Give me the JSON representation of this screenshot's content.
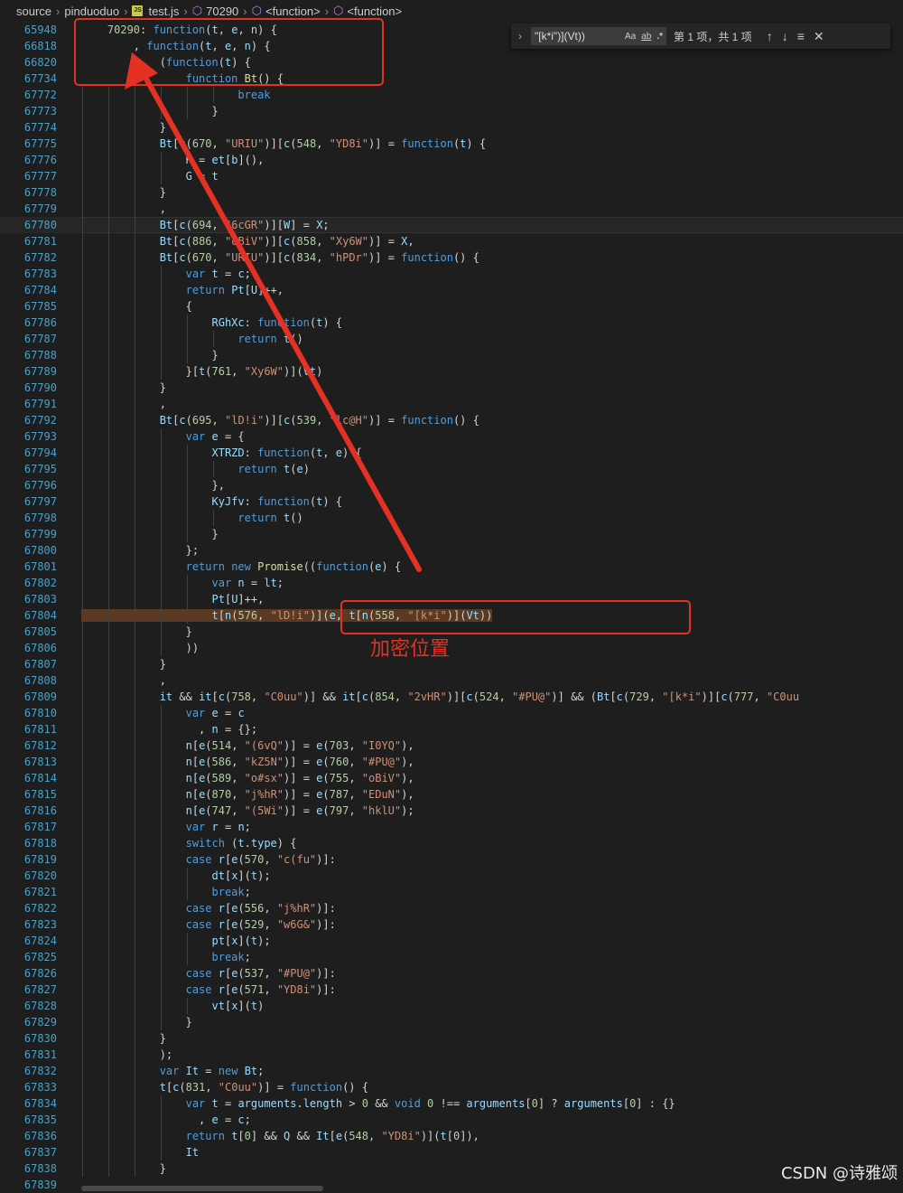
{
  "breadcrumb": [
    "source",
    "pinduoduo",
    "test.js",
    "70290",
    "<function>",
    "<function>"
  ],
  "find_widget": {
    "query": "\"[k*i\")](Vt))",
    "match_case_label": "Aa",
    "whole_word_label": "ab",
    "regex_label": ".*",
    "result": "第 1 项，共 1 项"
  },
  "sticky_lines": [
    {
      "number": "65948",
      "code": "    70290: function(t, e, n) {"
    },
    {
      "number": "66818",
      "code": "        , function(t, e, n) {"
    },
    {
      "number": "66820",
      "code": "            (function(t) {"
    },
    {
      "number": "67734",
      "code": "                function Bt() {"
    }
  ],
  "code_lines": [
    {
      "number": "67772",
      "code": "                        break"
    },
    {
      "number": "67773",
      "code": "                    }"
    },
    {
      "number": "67774",
      "code": "            }"
    },
    {
      "number": "67775",
      "code": "            Bt[c(670, \"URIU\")][c(548, \"YD8i\")] = function(t) {"
    },
    {
      "number": "67776",
      "code": "                K = et[b](),"
    },
    {
      "number": "67777",
      "code": "                G = t"
    },
    {
      "number": "67778",
      "code": "            }"
    },
    {
      "number": "67779",
      "code": "            ,"
    },
    {
      "number": "67780",
      "code": "            Bt[c(694, \"6cGR\")][W] = X;"
    },
    {
      "number": "67781",
      "code": "            Bt[c(886, \"oBiV\")][c(858, \"Xy6W\")] = X,"
    },
    {
      "number": "67782",
      "code": "            Bt[c(670, \"URIU\")][c(834, \"hPDr\")] = function() {"
    },
    {
      "number": "67783",
      "code": "                var t = c;"
    },
    {
      "number": "67784",
      "code": "                return Pt[U]++,"
    },
    {
      "number": "67785",
      "code": "                {"
    },
    {
      "number": "67786",
      "code": "                    RGhXc: function(t) {"
    },
    {
      "number": "67787",
      "code": "                        return t()"
    },
    {
      "number": "67788",
      "code": "                    }"
    },
    {
      "number": "67789",
      "code": "                }[t(761, \"Xy6W\")](Vt)"
    },
    {
      "number": "67790",
      "code": "            }"
    },
    {
      "number": "67791",
      "code": "            ,"
    },
    {
      "number": "67792",
      "code": "            Bt[c(695, \"lD!i\")][c(539, \"lc@H\")] = function() {"
    },
    {
      "number": "67793",
      "code": "                var e = {"
    },
    {
      "number": "67794",
      "code": "                    XTRZD: function(t, e) {"
    },
    {
      "number": "67795",
      "code": "                        return t(e)"
    },
    {
      "number": "67796",
      "code": "                    },"
    },
    {
      "number": "67797",
      "code": "                    KyJfv: function(t) {"
    },
    {
      "number": "67798",
      "code": "                        return t()"
    },
    {
      "number": "67799",
      "code": "                    }"
    },
    {
      "number": "67800",
      "code": "                };"
    },
    {
      "number": "67801",
      "code": "                return new Promise((function(e) {"
    },
    {
      "number": "67802",
      "code": "                    var n = lt;"
    },
    {
      "number": "67803",
      "code": "                    Pt[U]++,"
    },
    {
      "number": "67804",
      "code": "                    t[n(576, \"lD!i\")](e, t[n(558, \"[k*i\")](Vt))"
    },
    {
      "number": "67805",
      "code": "                }"
    },
    {
      "number": "67806",
      "code": "                ))"
    },
    {
      "number": "67807",
      "code": "            }"
    },
    {
      "number": "67808",
      "code": "            ,"
    },
    {
      "number": "67809",
      "code": "            it && it[c(758, \"C0uu\")] && it[c(854, \"2vHR\")][c(524, \"#PU@\")] && (Bt[c(729, \"[k*i\")][c(777, \"C0uu"
    },
    {
      "number": "67810",
      "code": "                var e = c"
    },
    {
      "number": "67811",
      "code": "                  , n = {};"
    },
    {
      "number": "67812",
      "code": "                n[e(514, \"(6vQ\")] = e(703, \"I0YQ\"),"
    },
    {
      "number": "67813",
      "code": "                n[e(586, \"kZ5N\")] = e(760, \"#PU@\"),"
    },
    {
      "number": "67814",
      "code": "                n[e(589, \"o#sx\")] = e(755, \"oBiV\"),"
    },
    {
      "number": "67815",
      "code": "                n[e(870, \"j%hR\")] = e(787, \"EDuN\"),"
    },
    {
      "number": "67816",
      "code": "                n[e(747, \"(5Wi\")] = e(797, \"hklU\");"
    },
    {
      "number": "67817",
      "code": "                var r = n;"
    },
    {
      "number": "67818",
      "code": "                switch (t.type) {"
    },
    {
      "number": "67819",
      "code": "                case r[e(570, \"c(fu\")]:"
    },
    {
      "number": "67820",
      "code": "                    dt[x](t);"
    },
    {
      "number": "67821",
      "code": "                    break;"
    },
    {
      "number": "67822",
      "code": "                case r[e(556, \"j%hR\")]:"
    },
    {
      "number": "67823",
      "code": "                case r[e(529, \"w6G&\")]:"
    },
    {
      "number": "67824",
      "code": "                    pt[x](t);"
    },
    {
      "number": "67825",
      "code": "                    break;"
    },
    {
      "number": "67826",
      "code": "                case r[e(537, \"#PU@\")]:"
    },
    {
      "number": "67827",
      "code": "                case r[e(571, \"YD8i\")]:"
    },
    {
      "number": "67828",
      "code": "                    vt[x](t)"
    },
    {
      "number": "67829",
      "code": "                }"
    },
    {
      "number": "67830",
      "code": "            }"
    },
    {
      "number": "67831",
      "code": "            );"
    },
    {
      "number": "67832",
      "code": "            var It = new Bt;"
    },
    {
      "number": "67833",
      "code": "            t[c(831, \"C0uu\")] = function() {"
    },
    {
      "number": "67834",
      "code": "                var t = arguments.length > 0 && void 0 !== arguments[0] ? arguments[0] : {}"
    },
    {
      "number": "67835",
      "code": "                  , e = c;"
    },
    {
      "number": "67836",
      "code": "                return t[0] && Q && It[e(548, \"YD8i\")](t[0]),"
    },
    {
      "number": "67837",
      "code": "                It"
    },
    {
      "number": "67838",
      "code": "            }"
    },
    {
      "number": "67839",
      "code": ""
    }
  ],
  "annotation": "加密位置",
  "watermark": "CSDN @诗雅颂",
  "colors": {
    "annotation_red": "#e53123",
    "line_number": "#4aa0c8",
    "keyword": "#569cd6",
    "string": "#ce9178",
    "function_name": "#dcdcaa",
    "background": "#1e1e1e",
    "match_highlight": "#5a3a22"
  }
}
